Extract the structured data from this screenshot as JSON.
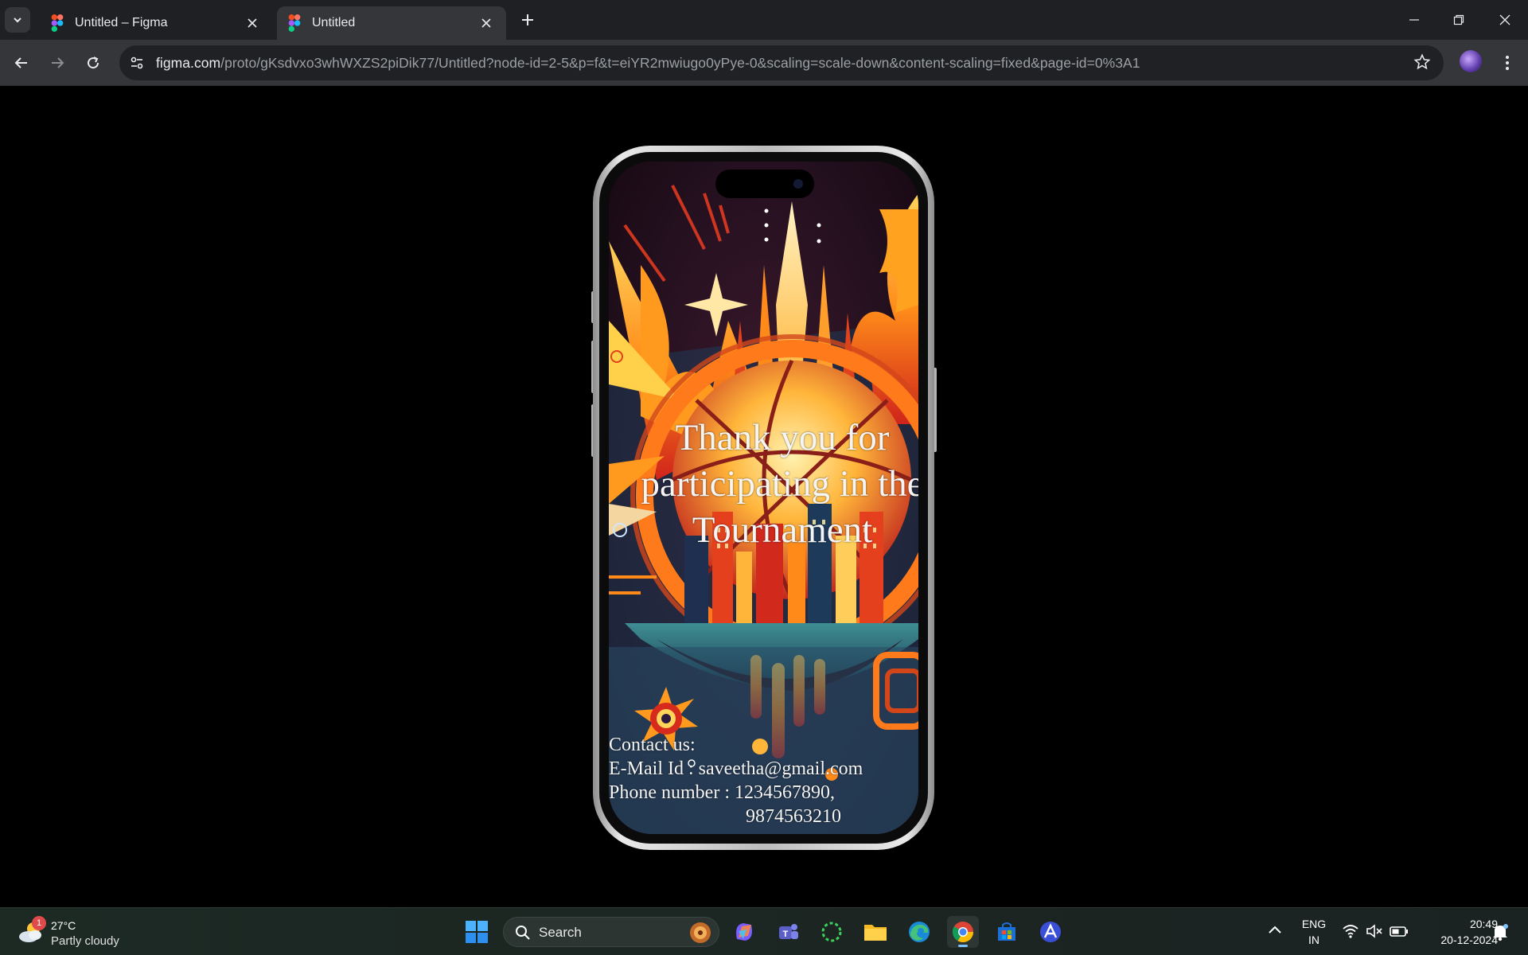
{
  "browser": {
    "tabs": [
      {
        "title": "Untitled – Figma",
        "active": false
      },
      {
        "title": "Untitled",
        "active": true
      }
    ],
    "url_host": "figma.com",
    "url_path": "/proto/gKsdvxo3whWXZS2piDik77/Untitled?node-id=2-5&p=f&t=eiYR2mwiugo0yPye-0&scaling=scale-down&content-scaling=fixed&page-id=0%3A1"
  },
  "prototype": {
    "headline": "Thank you for participating in the Tournament",
    "contact_heading": "Contact us:",
    "email_line": "E-Mail Id : saveetha@gmail.com",
    "phone_line": "Phone number : 1234567890,",
    "phone_line_2": "9874563210"
  },
  "taskbar": {
    "weather_badge": "1",
    "temperature": "27°C",
    "condition": "Partly cloudy",
    "search_label": "Search",
    "lang_1": "ENG",
    "lang_2": "IN",
    "time": "20:49",
    "date": "20-12-2024"
  },
  "colors": {
    "tab_bg": "#1f2023",
    "toolbar_bg": "#35363a",
    "accent": "#7ec3ff"
  }
}
